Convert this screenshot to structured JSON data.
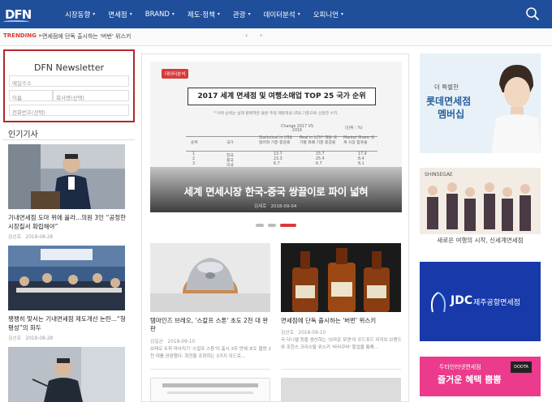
{
  "header": {
    "logo": "DFN",
    "nav": [
      {
        "label": "시장동향",
        "caret": "▾"
      },
      {
        "label": "면세점",
        "caret": "▾"
      },
      {
        "label": "BRAND",
        "caret": "▾"
      },
      {
        "label": "제도·정책",
        "caret": "▾"
      },
      {
        "label": "관광",
        "caret": "▾"
      },
      {
        "label": "데이터분석",
        "caret": "▾"
      },
      {
        "label": "오피니언",
        "caret": "▾"
      }
    ],
    "search_icon": "search-icon"
  },
  "trending": {
    "label": "TRENDING »",
    "title": "면세점에 단독 출시하는 '버번' 위스키",
    "prev": "‹",
    "next": "›"
  },
  "newsletter": {
    "title": "DFN Newsletter",
    "email_placeholder": "메일주소",
    "name_placeholder": "이름",
    "company_placeholder": "회사명(선택)",
    "phone_placeholder": "전화번호(선택)"
  },
  "sidebar": {
    "heading": "인기기사",
    "articles": [
      {
        "title": "기내면세점 도마 위에 올라...의원 3인 “공정한 시장질서 확립해야”",
        "author": "김선호",
        "date": "2018-08-28"
      },
      {
        "title": "팽팽히 맞서는 기내면세점 제도개선 논란...“형평성”의 화두",
        "author": "김선호",
        "date": "2018-08-28"
      },
      {
        "title": "",
        "author": "",
        "date": ""
      }
    ]
  },
  "hero": {
    "badge": "데이터분석",
    "headline_image_text": "2017 세계 면세점 및 여행소매업 TOP 25 국가 순위",
    "note": "* 아래 순위는 실제 판매액은 물론 추정 매출액을 US$ 기준으로 산정한 수치.",
    "table_headers": [
      "순위",
      "국가",
      "Statistical in US$ 달러화 기준 증감률",
      "Real in LCU* 해당 국가별 화폐 기준 증감률",
      "Market Share 세계 시장 점유율"
    ],
    "table_rows": [
      [
        "1",
        "한국",
        "13.7",
        "15.7",
        "17.9"
      ],
      [
        "2",
        "중국",
        "23.3",
        "25.4",
        "8.4"
      ],
      [
        "3",
        "미국",
        "6.7",
        "6.7",
        "8.1"
      ]
    ],
    "table_top": "Change 2017 VS 2016",
    "table_unit": "(단위 : %)",
    "caption": "세계 면세시장 한국-중국 쌍끌이로 파이 넓혀",
    "author": "김세로",
    "date": "2018-09-04"
  },
  "cards": [
    {
      "title": "템마인즈 브레오, '스칼프 스톤' 초도 2천 대 완판",
      "author": "김일균",
      "date": "2018-09-10",
      "summary": "브레오 두피 마사지기 '스칼프 스톤'이 출시 3주 만에 초도 물량 2천 대를 완판했다. 회전을 조정하는 3가지 모드로..."
    },
    {
      "title": "면세점에 단독 출시하는 '버번' 위스키",
      "author": "김선호",
      "date": "2018-09-10",
      "summary": "국 다니엘 등을 생산하는 '브라운 포맨'이 우드포드 리저브 브랜드와 조한스 크리스탈 위스키 '바라쿠바' 할업을 통해..."
    }
  ],
  "ads": [
    {
      "small": "더 특별한",
      "big1": "롯데면세점",
      "big2": "멤버십"
    },
    {
      "top": "SHINSEGAE",
      "bottom": "새로운 여행의 시작, 신세계면세점"
    },
    {
      "logo": "JDC",
      "text": "제주공항면세점"
    },
    {
      "top": "두타인터넷면세점",
      "bottom": "즐거운 혜택 뿜뿜",
      "tag": "DOOTA"
    }
  ],
  "colors": {
    "nav_bg": "#1f4e9a",
    "accent_red": "#d93a3a",
    "newsletter_border": "#b02a2a"
  }
}
